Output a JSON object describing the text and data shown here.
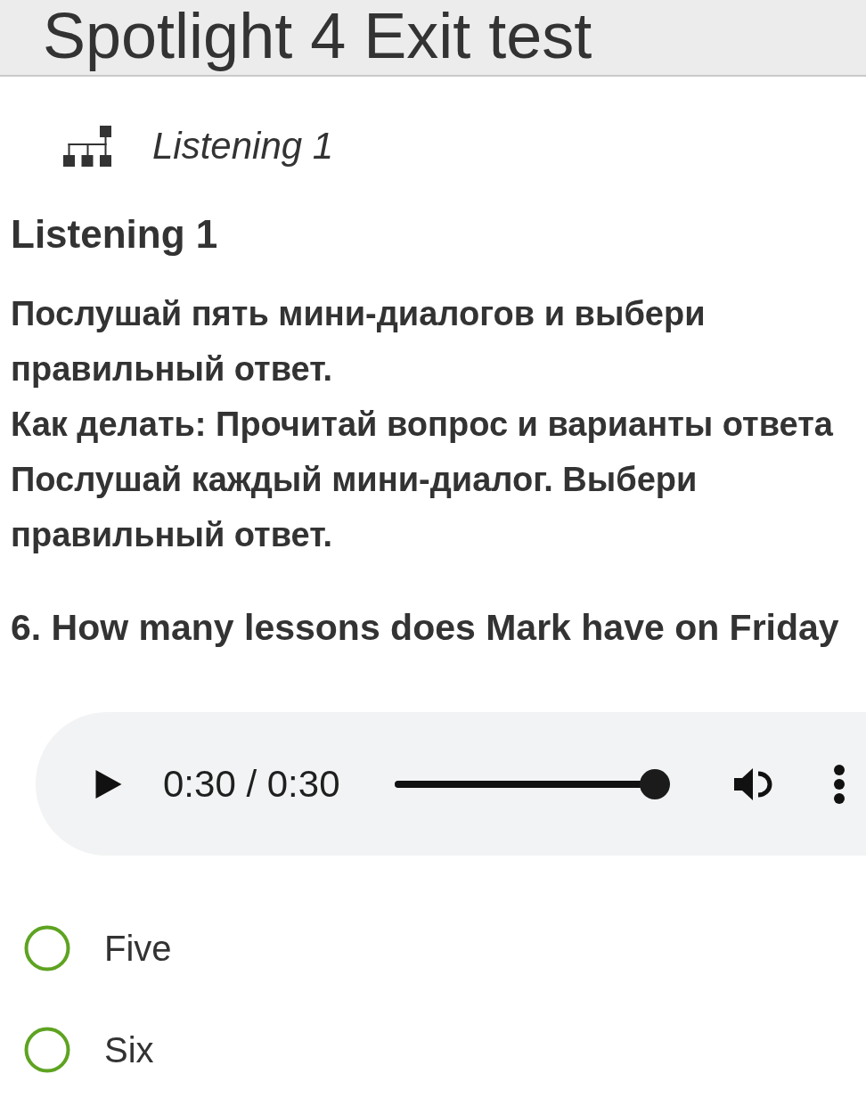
{
  "header": {
    "title": "Spotlight 4 Exit test"
  },
  "breadcrumb": {
    "label": "Listening 1"
  },
  "section": {
    "heading": "Listening 1",
    "instructions": [
      "Послушай пять мини-диалогов и выбери правильный ответ.",
      "Как делать: Прочитай вопрос и варианты ответа Послушай каждый мини-диалог. Выбери правильный ответ."
    ]
  },
  "question": {
    "text": "6. How many lessons does Mark have on Friday",
    "audio": {
      "playing": false,
      "time": "0:30 / 0:30",
      "level": 1
    },
    "options": [
      {
        "label": "Five",
        "selected": false
      },
      {
        "label": "Six",
        "selected": false
      }
    ]
  }
}
